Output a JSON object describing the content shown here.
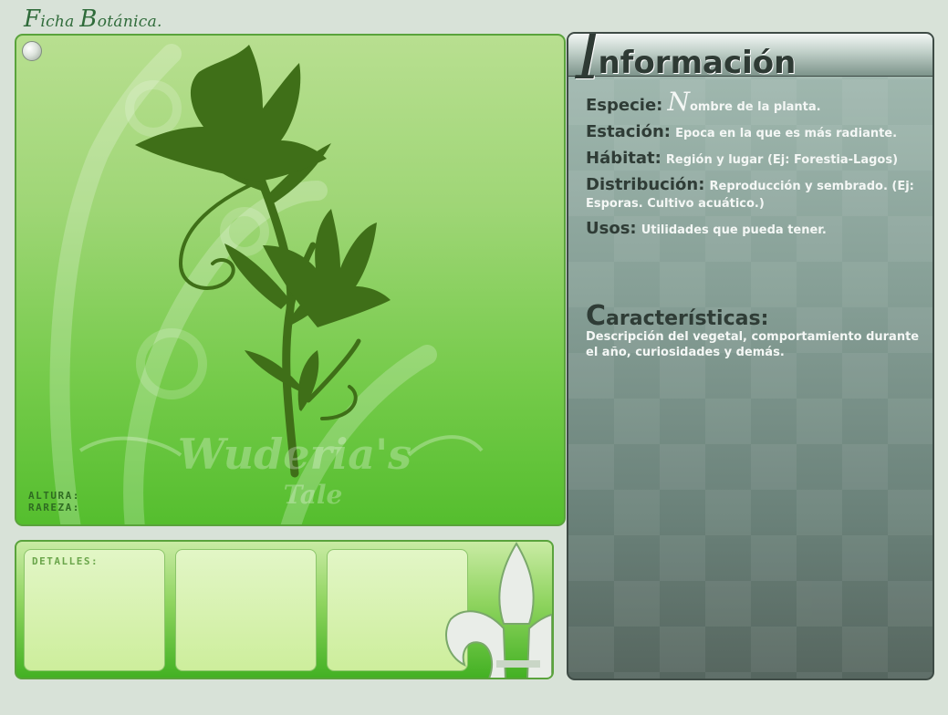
{
  "page": {
    "title_cap1": "F",
    "title_rest1": "icha ",
    "title_cap2": "B",
    "title_rest2": "otánica."
  },
  "image_panel": {
    "watermark_line1": "Wuderia's",
    "watermark_line2": "Tale",
    "height_label": "ALTURA:",
    "rarity_label": "RAREZA:"
  },
  "details": {
    "label": "DETALLES:"
  },
  "info": {
    "title_cap": "I",
    "title_rest": "nformación",
    "fields": [
      {
        "label": "Especie:",
        "value_cap": "N",
        "value": "ombre de la planta."
      },
      {
        "label": "Estación:",
        "value": "Epoca en la que es más radiante."
      },
      {
        "label": "Hábitat:",
        "value": "Región y lugar (Ej: Forestia-Lagos)"
      },
      {
        "label": "Distribución:",
        "value": "Reproducción y sembrado. (Ej: Esporas. Cultivo acuático.)"
      },
      {
        "label": "Usos:",
        "value": "Utilidades que pueda tener."
      }
    ],
    "characteristics": {
      "title_cap": "C",
      "title_rest": "aracterísticas:",
      "text": "Descripción del vegetal, comportamiento durante el año, curiosidades y demás."
    }
  },
  "colors": {
    "page_bg": "#d8e2d8",
    "green_frame": "#5aa33c",
    "silhouette": "#3f6f18",
    "info_label": "#2f3c36"
  }
}
